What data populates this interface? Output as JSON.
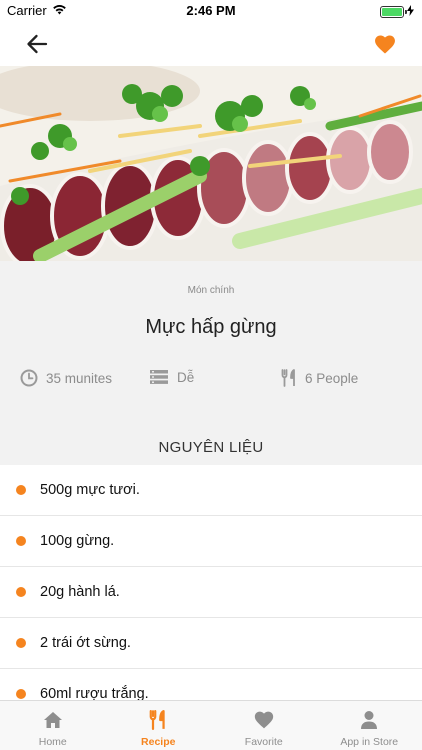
{
  "status_bar": {
    "carrier": "Carrier",
    "time": "2:46 PM",
    "battery_level": 1.0
  },
  "nav": {
    "back_icon": "arrow-left-icon",
    "favorite_icon": "heart-icon"
  },
  "recipe": {
    "category": "Món chính",
    "title": "Mực hấp gừng",
    "time": "35 munites",
    "difficulty": "Dễ",
    "servings": "6 People",
    "ingredients_title": "NGUYÊN LIỆU",
    "ingredients": [
      "500g mực tươi.",
      "100g gừng.",
      "20g hành lá.",
      "2 trái ớt sừng.",
      "60ml rượu trắng."
    ]
  },
  "tabs": [
    {
      "label": "Home",
      "icon": "home-icon",
      "active": false
    },
    {
      "label": "Recipe",
      "icon": "fork-knife-icon",
      "active": true
    },
    {
      "label": "Favorite",
      "icon": "heart-icon",
      "active": false
    },
    {
      "label": "App in Store",
      "icon": "user-icon",
      "active": false
    }
  ],
  "colors": {
    "accent": "#f5841f",
    "info_background": "#f2f2f2",
    "muted_text": "#8c8c8c"
  }
}
